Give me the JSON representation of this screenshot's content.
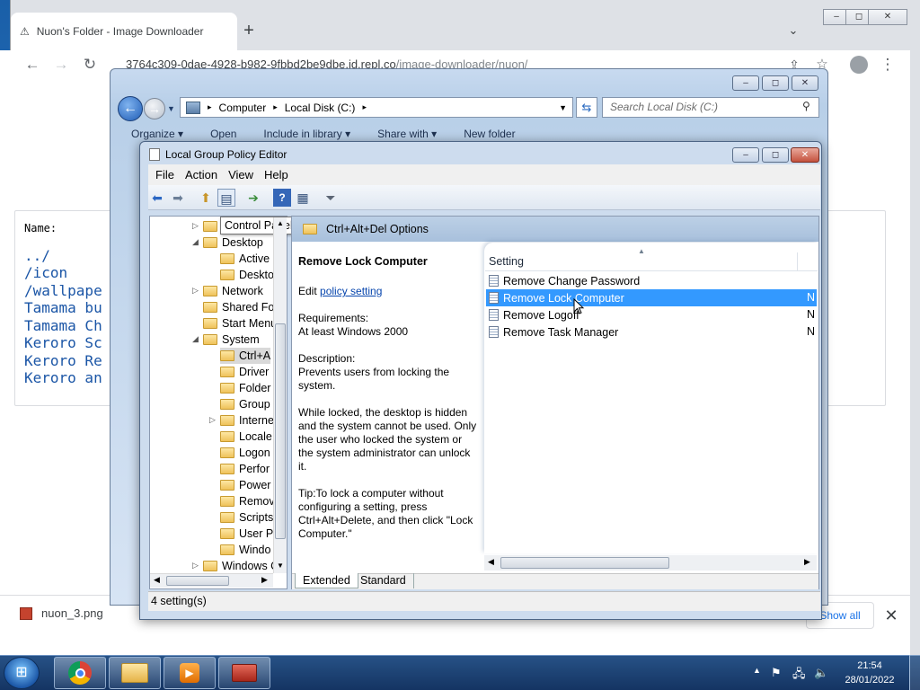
{
  "chrome": {
    "tab_title": "Nuon's Folder - Image Downloader",
    "new_tab": "+",
    "tab_search": "⌄",
    "win_buttons": [
      "–",
      "◻",
      "✕"
    ],
    "url_main": "3764c309-0dae-4928-b982-9fbbd2be9dbe.id.repl.co",
    "url_path": "/image-downloader/nuon/",
    "page": {
      "name_label": "Name:",
      "links": [
        "../",
        "/icon",
        "/wallpape",
        "Tamama bu",
        "Tamama Ch",
        "Keroro Sc",
        "Keroro Re",
        "Keroro an"
      ]
    },
    "download": {
      "file_name": "nuon_3.png",
      "show_all": "Show all",
      "close": "✕"
    }
  },
  "explorer": {
    "address_parts": [
      "Computer",
      "Local Disk (C:)"
    ],
    "search_placeholder": "Search Local Disk (C:)",
    "toolbar": [
      "Organize ▾",
      "Open",
      "Include in library ▾",
      "Share with ▾",
      "New folder"
    ],
    "win_buttons": [
      "–",
      "◻",
      "✕"
    ]
  },
  "gpedit": {
    "title": "Local Group Policy Editor",
    "menu": [
      "File",
      "Action",
      "View",
      "Help"
    ],
    "win_buttons": [
      "–",
      "◻",
      "✕"
    ],
    "tree_tooltip": "Control Panel",
    "tree": [
      {
        "label": "Control Pa",
        "level": 3,
        "toggle": "▷"
      },
      {
        "label": "Desktop",
        "level": 3,
        "toggle": "◢"
      },
      {
        "label": "Active",
        "level": 4,
        "toggle": ""
      },
      {
        "label": "Deskto",
        "level": 4,
        "toggle": ""
      },
      {
        "label": "Network",
        "level": 3,
        "toggle": "▷"
      },
      {
        "label": "Shared Fol",
        "level": 3,
        "toggle": ""
      },
      {
        "label": "Start Menu",
        "level": 3,
        "toggle": ""
      },
      {
        "label": "System",
        "level": 3,
        "toggle": "◢"
      },
      {
        "label": "Ctrl+A",
        "level": 4,
        "toggle": "",
        "selected": true
      },
      {
        "label": "Driver",
        "level": 4,
        "toggle": ""
      },
      {
        "label": "Folder",
        "level": 4,
        "toggle": ""
      },
      {
        "label": "Group",
        "level": 4,
        "toggle": ""
      },
      {
        "label": "Interne",
        "level": 4,
        "toggle": "▷"
      },
      {
        "label": "Locale",
        "level": 4,
        "toggle": ""
      },
      {
        "label": "Logon",
        "level": 4,
        "toggle": ""
      },
      {
        "label": "Perfor",
        "level": 4,
        "toggle": ""
      },
      {
        "label": "Power",
        "level": 4,
        "toggle": ""
      },
      {
        "label": "Remov",
        "level": 4,
        "toggle": ""
      },
      {
        "label": "Scripts",
        "level": 4,
        "toggle": ""
      },
      {
        "label": "User Pr",
        "level": 4,
        "toggle": ""
      },
      {
        "label": "Windo",
        "level": 4,
        "toggle": ""
      },
      {
        "label": "Windows C",
        "level": 3,
        "toggle": "▷"
      }
    ],
    "header_title": "Ctrl+Alt+Del Options",
    "description": {
      "title": "Remove Lock Computer",
      "edit_prefix": "Edit",
      "edit_link": "policy setting",
      "requirements": "Requirements:\nAt least Windows 2000",
      "description": "Description:\nPrevents users from locking the system.",
      "detail": "While locked, the desktop is hidden and the system cannot be used. Only the user who locked the system or the system administrator can unlock it.",
      "tip": "Tip:To lock a computer without configuring a setting, press Ctrl+Alt+Delete, and then click \"Lock Computer.\""
    },
    "list_header": "Setting",
    "settings": [
      {
        "name": "Remove Change Password",
        "state": "",
        "selected": false
      },
      {
        "name": "Remove Lock Computer",
        "state": "N",
        "selected": true
      },
      {
        "name": "Remove Logoff",
        "state": "N",
        "selected": false
      },
      {
        "name": "Remove Task Manager",
        "state": "N",
        "selected": false
      }
    ],
    "tabs": [
      "Extended",
      "Standard"
    ],
    "status": "4 setting(s)"
  },
  "taskbar": {
    "time": "21:54",
    "date": "28/01/2022",
    "apps": [
      "chrome-icon",
      "explorer-icon",
      "media-player-icon",
      "toolbox-icon"
    ]
  }
}
